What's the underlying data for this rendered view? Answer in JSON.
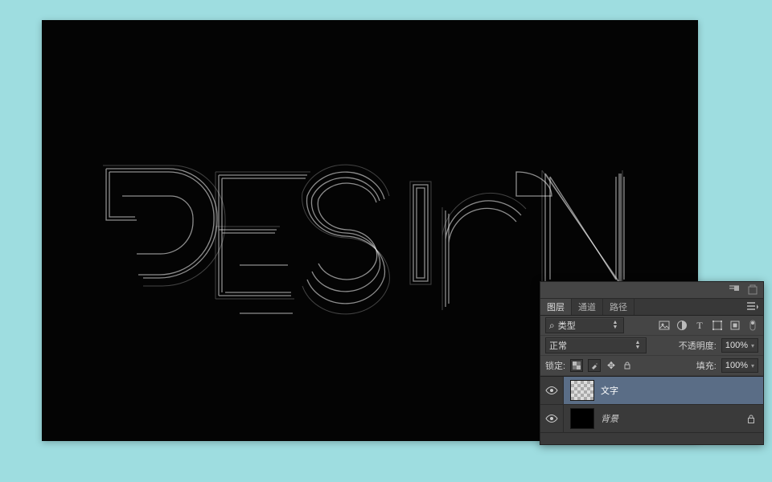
{
  "canvas": {
    "artwork_label": "DESIGN"
  },
  "panel": {
    "tabs": {
      "layers": "图层",
      "channels": "通道",
      "paths": "路径"
    },
    "filter": {
      "label_prefix": "ρ",
      "kind": "类型"
    },
    "blend": {
      "mode": "正常",
      "opacity_label": "不透明度:",
      "opacity_value": "100%"
    },
    "lock": {
      "label": "锁定:",
      "fill_label": "填充:",
      "fill_value": "100%"
    },
    "layers": [
      {
        "name": "文字",
        "selected": true,
        "thumb": "checker",
        "locked": false
      },
      {
        "name": "背景",
        "selected": false,
        "thumb": "black",
        "locked": true
      }
    ]
  }
}
